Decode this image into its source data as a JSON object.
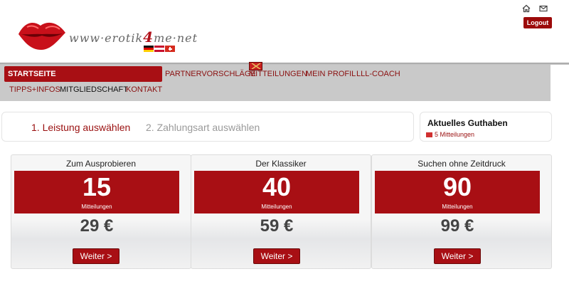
{
  "header": {
    "logo_text_pre": "www·erotik",
    "logo_text_accent": "4",
    "logo_text_post": "me·net",
    "home_icon": "home-icon",
    "mail_icon": "mail-icon",
    "logout_label": "Logout"
  },
  "nav": {
    "row1": [
      "STARTSEITE",
      "PARTNERVORSCHLÄGE",
      "MITTEILUNGEN",
      "MEIN PROFIL",
      "LLL-COACH"
    ],
    "row2": [
      "TIPPS+INFOS",
      "MITGLIEDSCHAFT",
      "KONTAKT"
    ]
  },
  "steps": {
    "step1": "1. Leistung auswählen",
    "step2": "2. Zahlungsart auswählen"
  },
  "credit": {
    "title": "Aktuelles Guthaben",
    "value": "5 Mitteilungen"
  },
  "cards": [
    {
      "title": "Zum Ausprobieren",
      "count": "15",
      "unit": "Mitteilungen",
      "price": "29 €",
      "button": "Weiter >"
    },
    {
      "title": "Der Klassiker",
      "count": "40",
      "unit": "Mitteilungen",
      "price": "59 €",
      "button": "Weiter >"
    },
    {
      "title": "Suchen ohne Zeitdruck",
      "count": "90",
      "unit": "Mitteilungen",
      "price": "99 €",
      "button": "Weiter >"
    }
  ],
  "colors": {
    "brand_red": "#a80f14",
    "nav_gray": "#c9c9c9"
  }
}
